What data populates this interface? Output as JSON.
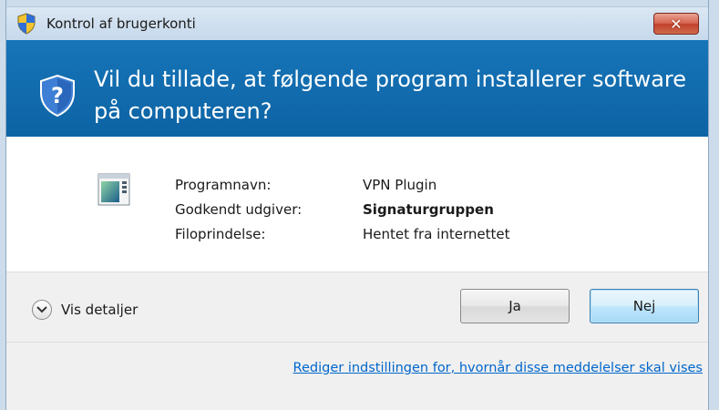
{
  "window": {
    "title": "Kontrol af brugerkonti",
    "close_label": "✕"
  },
  "header": {
    "question": "Vil du tillade, at følgende program installerer software på computeren?"
  },
  "program_info": {
    "rows": [
      {
        "label": "Programnavn:",
        "value": "VPN Plugin"
      },
      {
        "label": "Godkendt udgiver:",
        "value": "Signaturgruppen"
      },
      {
        "label": "Filoprindelse:",
        "value": "Hentet fra internettet"
      }
    ]
  },
  "footer": {
    "details_label": "Vis detaljer",
    "yes_label": "Ja",
    "no_label": "Nej",
    "settings_link": "Rediger indstillingen for, hvornår disse meddelelser skal vises"
  },
  "colors": {
    "header_blue": "#0e69ac",
    "link_blue": "#0066cc",
    "close_red": "#c1412c"
  },
  "icons": {
    "title_icon": "uac-shield-icon",
    "header_icon": "question-shield-icon",
    "program_icon": "program-window-icon",
    "details_icon": "chevron-down-icon"
  }
}
